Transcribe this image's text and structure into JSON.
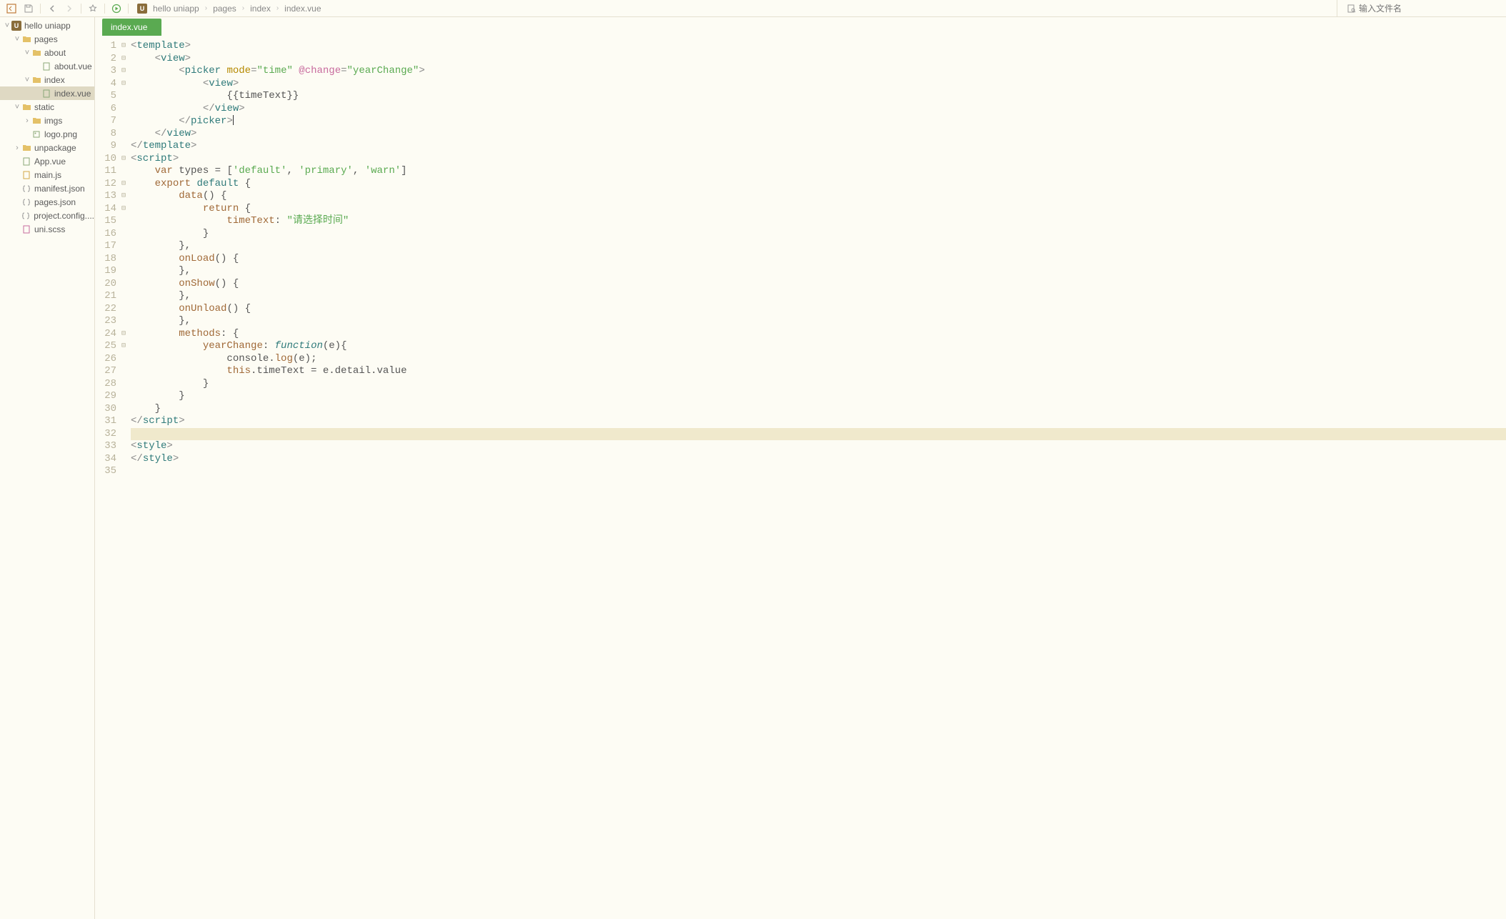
{
  "search": {
    "placeholder": "输入文件名"
  },
  "breadcrumb": [
    "hello uniapp",
    "pages",
    "index",
    "index.vue"
  ],
  "tab": {
    "label": "index.vue"
  },
  "tree": [
    {
      "name": "hello uniapp",
      "type": "project",
      "depth": 0,
      "open": true
    },
    {
      "name": "pages",
      "type": "folder",
      "depth": 1,
      "open": true
    },
    {
      "name": "about",
      "type": "folder",
      "depth": 2,
      "open": true
    },
    {
      "name": "about.vue",
      "type": "file-vue",
      "depth": 3
    },
    {
      "name": "index",
      "type": "folder",
      "depth": 2,
      "open": true
    },
    {
      "name": "index.vue",
      "type": "file-vue",
      "depth": 3,
      "active": true
    },
    {
      "name": "static",
      "type": "folder",
      "depth": 1,
      "open": true
    },
    {
      "name": "imgs",
      "type": "folder",
      "depth": 2,
      "open": false
    },
    {
      "name": "logo.png",
      "type": "file-img",
      "depth": 2
    },
    {
      "name": "unpackage",
      "type": "folder",
      "depth": 1,
      "open": false
    },
    {
      "name": "App.vue",
      "type": "file-vue",
      "depth": 1
    },
    {
      "name": "main.js",
      "type": "file-js",
      "depth": 1
    },
    {
      "name": "manifest.json",
      "type": "file-json",
      "depth": 1
    },
    {
      "name": "pages.json",
      "type": "file-json",
      "depth": 1
    },
    {
      "name": "project.config....",
      "type": "file-json",
      "depth": 1
    },
    {
      "name": "uni.scss",
      "type": "file-scss",
      "depth": 1
    }
  ],
  "code": {
    "lines": [
      {
        "n": 1,
        "fold": "open",
        "tokens": [
          [
            "t-punc",
            "<"
          ],
          [
            "t-tag",
            "template"
          ],
          [
            "t-punc",
            ">"
          ]
        ]
      },
      {
        "n": 2,
        "fold": "open",
        "indent": 1,
        "tokens": [
          [
            "t-punc",
            "<"
          ],
          [
            "t-tag",
            "view"
          ],
          [
            "t-punc",
            ">"
          ]
        ]
      },
      {
        "n": 3,
        "fold": "open",
        "indent": 2,
        "tokens": [
          [
            "t-punc",
            "<"
          ],
          [
            "t-tag",
            "picker"
          ],
          [
            "",
            ", "
          ],
          [
            "t-attr",
            "mode"
          ],
          [
            "t-punc",
            "="
          ],
          [
            "t-str",
            "\"time\""
          ],
          [
            "",
            ", "
          ],
          [
            "t-pink",
            "@change"
          ],
          [
            "t-punc",
            "="
          ],
          [
            "t-str",
            "\"yearChange\""
          ],
          [
            "t-punc",
            ">"
          ]
        ]
      },
      {
        "n": 4,
        "fold": "open",
        "indent": 3,
        "tokens": [
          [
            "t-punc",
            "<"
          ],
          [
            "t-tag",
            "view"
          ],
          [
            "t-punc",
            ">"
          ]
        ]
      },
      {
        "n": 5,
        "indent": 4,
        "tokens": [
          [
            "t-default",
            "{{timeText}}"
          ]
        ]
      },
      {
        "n": 6,
        "indent": 3,
        "tokens": [
          [
            "t-punc",
            "</"
          ],
          [
            "t-tag",
            "view"
          ],
          [
            "t-punc",
            ">"
          ]
        ]
      },
      {
        "n": 7,
        "indent": 2,
        "tokens": [
          [
            "t-punc",
            "</"
          ],
          [
            "t-tag",
            "picker"
          ],
          [
            "t-punc",
            ">"
          ],
          [
            "cursor",
            "                "
          ]
        ]
      },
      {
        "n": 8,
        "indent": 1,
        "tokens": [
          [
            "t-punc",
            "</"
          ],
          [
            "t-tag",
            "view"
          ],
          [
            "t-punc",
            ">"
          ]
        ]
      },
      {
        "n": 9,
        "fold": "",
        "tokens": [
          [
            "t-punc",
            "</"
          ],
          [
            "t-tag",
            "template"
          ],
          [
            "t-punc",
            ">"
          ]
        ]
      },
      {
        "n": 10,
        "fold": "open",
        "tokens": [
          [
            "t-punc",
            "<"
          ],
          [
            "t-tag",
            "script"
          ],
          [
            "t-punc",
            ">"
          ]
        ]
      },
      {
        "n": 11,
        "indent": 1,
        "tokens": [
          [
            "t-keyword2",
            "var"
          ],
          [
            "t-default",
            " types = ["
          ],
          [
            "t-str",
            "'default'"
          ],
          [
            "t-default",
            ", "
          ],
          [
            "t-str",
            "'primary'"
          ],
          [
            "t-default",
            ", "
          ],
          [
            "t-str",
            "'warn'"
          ],
          [
            "t-default",
            "]"
          ]
        ]
      },
      {
        "n": 12,
        "fold": "open",
        "indent": 1,
        "tokens": [
          [
            "t-keyword2",
            "export"
          ],
          [
            "t-default",
            " "
          ],
          [
            "t-keyword",
            "default"
          ],
          [
            "t-default",
            " {"
          ]
        ]
      },
      {
        "n": 13,
        "fold": "open",
        "indent": 2,
        "tokens": [
          [
            "t-funcname",
            "data"
          ],
          [
            "t-default",
            "() {"
          ]
        ]
      },
      {
        "n": 14,
        "fold": "open",
        "indent": 3,
        "tokens": [
          [
            "t-keyword2",
            "return"
          ],
          [
            "t-default",
            " {"
          ]
        ]
      },
      {
        "n": 15,
        "indent": 4,
        "tokens": [
          [
            "t-prop",
            "timeText"
          ],
          [
            "t-default",
            ": "
          ],
          [
            "t-str",
            "\"请选择时间\""
          ]
        ]
      },
      {
        "n": 16,
        "indent": 3,
        "tokens": [
          [
            "t-default",
            "}"
          ]
        ]
      },
      {
        "n": 17,
        "indent": 2,
        "tokens": [
          [
            "t-default",
            "},"
          ]
        ]
      },
      {
        "n": 18,
        "indent": 2,
        "tokens": [
          [
            "t-funcname",
            "onLoad"
          ],
          [
            "t-default",
            "() {"
          ]
        ]
      },
      {
        "n": 19,
        "indent": 2,
        "tokens": [
          [
            "t-default",
            "},"
          ]
        ]
      },
      {
        "n": 20,
        "indent": 2,
        "tokens": [
          [
            "t-funcname",
            "onShow"
          ],
          [
            "t-default",
            "() {"
          ]
        ]
      },
      {
        "n": 21,
        "indent": 2,
        "tokens": [
          [
            "t-default",
            "},"
          ]
        ]
      },
      {
        "n": 22,
        "indent": 2,
        "tokens": [
          [
            "t-funcname",
            "onUnload"
          ],
          [
            "t-default",
            "() {"
          ]
        ]
      },
      {
        "n": 23,
        "indent": 2,
        "tokens": [
          [
            "t-default",
            "},"
          ]
        ]
      },
      {
        "n": 24,
        "fold": "open",
        "indent": 2,
        "tokens": [
          [
            "t-prop",
            "methods"
          ],
          [
            "t-default",
            ": {"
          ]
        ]
      },
      {
        "n": 25,
        "fold": "open",
        "indent": 3,
        "tokens": [
          [
            "t-funcname",
            "yearChange"
          ],
          [
            "t-default",
            ": "
          ],
          [
            "t-func",
            "function"
          ],
          [
            "t-default",
            "(e){"
          ]
        ]
      },
      {
        "n": 26,
        "indent": 4,
        "tokens": [
          [
            "t-default",
            "console."
          ],
          [
            "t-funcname",
            "log"
          ],
          [
            "t-default",
            "(e);"
          ]
        ]
      },
      {
        "n": 27,
        "indent": 4,
        "tokens": [
          [
            "t-this",
            "this"
          ],
          [
            "t-default",
            ".timeText = e.detail.value"
          ]
        ]
      },
      {
        "n": 28,
        "indent": 3,
        "tokens": [
          [
            "t-default",
            "}"
          ]
        ]
      },
      {
        "n": 29,
        "indent": 2,
        "tokens": [
          [
            "t-default",
            "}"
          ]
        ]
      },
      {
        "n": 30,
        "indent": 1,
        "tokens": [
          [
            "t-default",
            "}"
          ]
        ]
      },
      {
        "n": 31,
        "tokens": [
          [
            "t-punc",
            "</"
          ],
          [
            "t-tag",
            "script"
          ],
          [
            "t-punc",
            ">"
          ]
        ]
      },
      {
        "n": 32,
        "hl": true,
        "tokens": []
      },
      {
        "n": 33,
        "tokens": [
          [
            "t-punc",
            "<"
          ],
          [
            "t-tag",
            "style"
          ],
          [
            "t-punc",
            ">"
          ]
        ]
      },
      {
        "n": 34,
        "tokens": [
          [
            "t-punc",
            "</"
          ],
          [
            "t-tag",
            "style"
          ],
          [
            "t-punc",
            ">"
          ]
        ]
      },
      {
        "n": 35,
        "tokens": []
      }
    ]
  }
}
